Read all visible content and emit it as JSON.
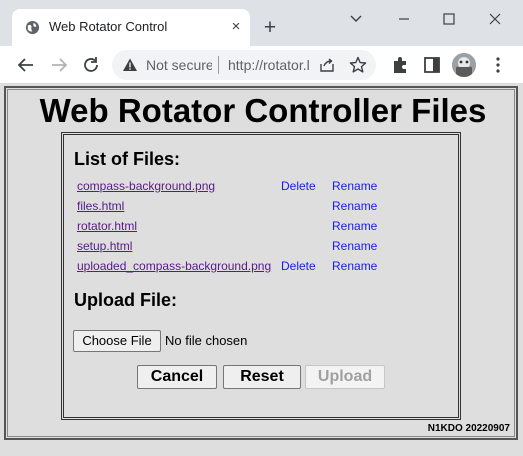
{
  "browser": {
    "tab_title": "Web Rotator Control",
    "tab_close": "×",
    "new_tab": "+",
    "security_label": "Not secure",
    "url": "http://rotator.local/files.html",
    "icons": [
      "globe-icon",
      "back-arrow-icon",
      "forward-arrow-icon",
      "reload-icon",
      "warning-icon",
      "share-icon",
      "star-icon",
      "extensions-icon",
      "sidebar-icon",
      "menu-icon"
    ]
  },
  "page": {
    "heading": "Web Rotator Controller Files",
    "list_title": "List of Files:",
    "files": [
      {
        "name": "compass-background.png",
        "delete": "Delete",
        "rename": "Rename"
      },
      {
        "name": "files.html",
        "delete": "",
        "rename": "Rename"
      },
      {
        "name": "rotator.html",
        "delete": "",
        "rename": "Rename"
      },
      {
        "name": "setup.html",
        "delete": "",
        "rename": "Rename"
      },
      {
        "name": "uploaded_compass-background.png",
        "delete": "Delete",
        "rename": "Rename"
      }
    ],
    "upload_title": "Upload File:",
    "choose_file": "Choose File",
    "no_file": "No file chosen",
    "cancel": "Cancel",
    "reset": "Reset",
    "upload": "Upload",
    "version": "N1KDO 20220907"
  },
  "colors": {
    "link_visited": "#551a8b",
    "link": "#1a1aee",
    "page_bg": "#dedede"
  }
}
